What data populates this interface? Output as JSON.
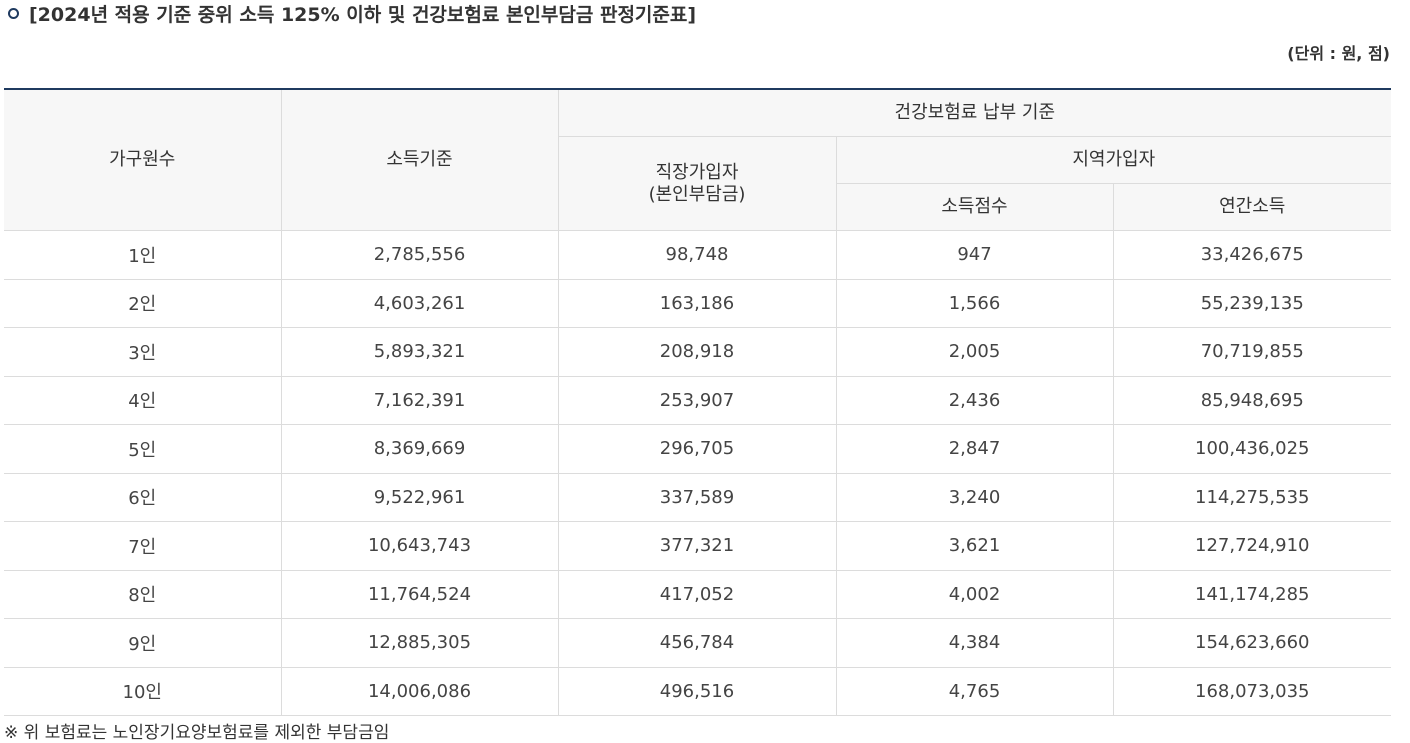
{
  "title": "[2024년 적용 기준 중위 소득 125% 이하 및 건강보험료 본인부담금 판정기준표]",
  "unit": "(단위 : 원, 점)",
  "headers": {
    "household": "가구원수",
    "income_standard": "소득기준",
    "insurance_group": "건강보험료 납부 기준",
    "employee": "직장가입자",
    "employee_sub": "(본인부담금)",
    "regional": "지역가입자",
    "income_score": "소득점수",
    "annual_income": "연간소득"
  },
  "rows": [
    {
      "household": "1인",
      "income": "2,785,556",
      "employee": "98,748",
      "score": "947",
      "annual": "33,426,675"
    },
    {
      "household": "2인",
      "income": "4,603,261",
      "employee": "163,186",
      "score": "1,566",
      "annual": "55,239,135"
    },
    {
      "household": "3인",
      "income": "5,893,321",
      "employee": "208,918",
      "score": "2,005",
      "annual": "70,719,855"
    },
    {
      "household": "4인",
      "income": "7,162,391",
      "employee": "253,907",
      "score": "2,436",
      "annual": "85,948,695"
    },
    {
      "household": "5인",
      "income": "8,369,669",
      "employee": "296,705",
      "score": "2,847",
      "annual": "100,436,025"
    },
    {
      "household": "6인",
      "income": "9,522,961",
      "employee": "337,589",
      "score": "3,240",
      "annual": "114,275,535"
    },
    {
      "household": "7인",
      "income": "10,643,743",
      "employee": "377,321",
      "score": "3,621",
      "annual": "127,724,910"
    },
    {
      "household": "8인",
      "income": "11,764,524",
      "employee": "417,052",
      "score": "4,002",
      "annual": "141,174,285"
    },
    {
      "household": "9인",
      "income": "12,885,305",
      "employee": "456,784",
      "score": "4,384",
      "annual": "154,623,660"
    },
    {
      "household": "10인",
      "income": "14,006,086",
      "employee": "496,516",
      "score": "4,765",
      "annual": "168,073,035"
    }
  ],
  "note": "※ 위 보험료는 노인장기요양보험료를 제외한 부담금임",
  "colors": {
    "accent": "#1f3a5f",
    "header_bg": "#f7f7f7",
    "border": "#dcdcdc"
  },
  "icons": {
    "title_bullet": "circle-bullet-icon"
  }
}
